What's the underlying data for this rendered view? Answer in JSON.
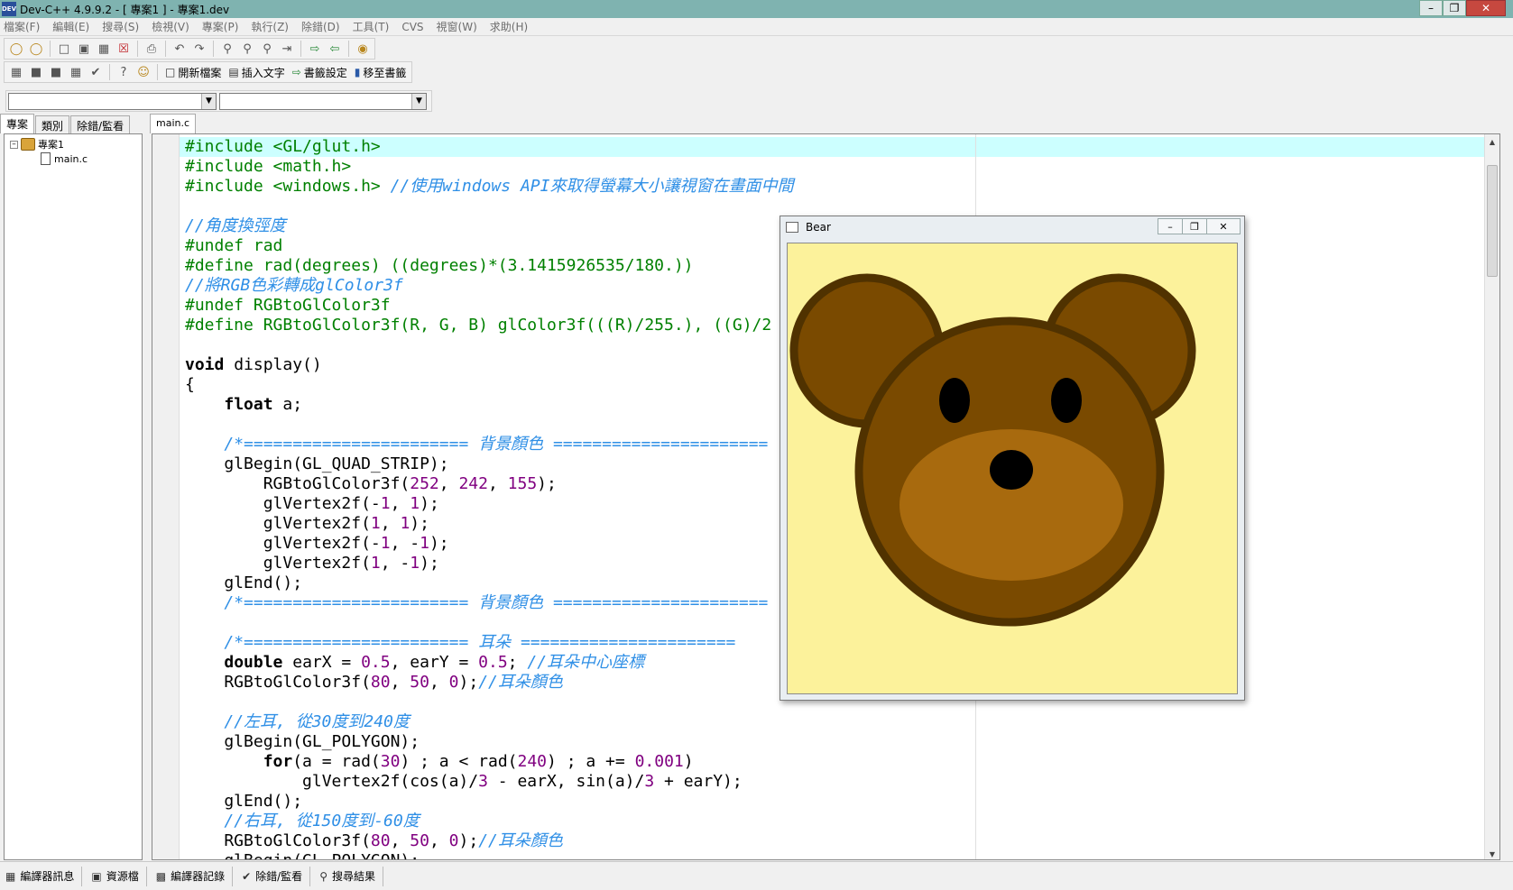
{
  "window": {
    "title": "Dev-C++ 4.9.9.2  - [ 專案1 ] - 專案1.dev",
    "icon_label": "DEV"
  },
  "menu": [
    "檔案(F)",
    "編輯(E)",
    "搜尋(S)",
    "檢視(V)",
    "專案(P)",
    "執行(Z)",
    "除錯(D)",
    "工具(T)",
    "CVS",
    "視窗(W)",
    "求助(H)"
  ],
  "toolbar2": {
    "new_file": "開新檔案",
    "insert_text": "插入文字",
    "bookmark_set": "書籤設定",
    "goto_bookmark": "移至書籤"
  },
  "left_tabs": [
    "專案",
    "類別",
    "除錯/監看"
  ],
  "project_tree": {
    "root": "專案1",
    "file": "main.c"
  },
  "editor_tab": "main.c",
  "bear_window": {
    "title": "Bear",
    "bg_color": "#fcf29b",
    "ear_color": "#7a4a00",
    "outline_color": "#503200",
    "muzzle_color": "#a86a0e"
  },
  "statusbar": [
    "編譯器訊息",
    "資源檔",
    "編譯器記錄",
    "除錯/監看",
    "搜尋結果"
  ],
  "code_lines": [
    [
      [
        "pp",
        "#include <GL/glut.h>"
      ]
    ],
    [
      [
        "pp",
        "#include <math.h>"
      ]
    ],
    [
      [
        "pp",
        "#include <windows.h> "
      ],
      [
        "cm",
        "//使用windows API來取得螢幕大小讓視窗在畫面中間"
      ]
    ],
    [],
    [
      [
        "cm",
        "//角度換弳度"
      ]
    ],
    [
      [
        "pp",
        "#undef rad"
      ]
    ],
    [
      [
        "pp",
        "#define rad(degrees) ((degrees)*(3.1415926535/180.))"
      ]
    ],
    [
      [
        "cm",
        "//將RGB色彩轉成glColor3f"
      ]
    ],
    [
      [
        "pp",
        "#undef RGBtoGlColor3f"
      ]
    ],
    [
      [
        "pp",
        "#define RGBtoGlColor3f(R, G, B) glColor3f(((R)/255.), ((G)/2"
      ]
    ],
    [],
    [
      [
        "kw",
        "void"
      ],
      [
        "tx",
        " display()"
      ]
    ],
    [
      [
        "tx",
        "{"
      ]
    ],
    [
      [
        "tx",
        "    "
      ],
      [
        "kw",
        "float"
      ],
      [
        "tx",
        " a;"
      ]
    ],
    [],
    [
      [
        "tx",
        "    "
      ],
      [
        "cm",
        "/*======================= 背景顏色 ======================"
      ]
    ],
    [
      [
        "tx",
        "    glBegin(GL_QUAD_STRIP);"
      ]
    ],
    [
      [
        "tx",
        "        RGBtoGlColor3f("
      ],
      [
        "num",
        "252"
      ],
      [
        "tx",
        ", "
      ],
      [
        "num",
        "242"
      ],
      [
        "tx",
        ", "
      ],
      [
        "num",
        "155"
      ],
      [
        "tx",
        ");"
      ]
    ],
    [
      [
        "tx",
        "        glVertex2f(-"
      ],
      [
        "num",
        "1"
      ],
      [
        "tx",
        ", "
      ],
      [
        "num",
        "1"
      ],
      [
        "tx",
        ");"
      ]
    ],
    [
      [
        "tx",
        "        glVertex2f("
      ],
      [
        "num",
        "1"
      ],
      [
        "tx",
        ", "
      ],
      [
        "num",
        "1"
      ],
      [
        "tx",
        ");"
      ]
    ],
    [
      [
        "tx",
        "        glVertex2f(-"
      ],
      [
        "num",
        "1"
      ],
      [
        "tx",
        ", -"
      ],
      [
        "num",
        "1"
      ],
      [
        "tx",
        ");"
      ]
    ],
    [
      [
        "tx",
        "        glVertex2f("
      ],
      [
        "num",
        "1"
      ],
      [
        "tx",
        ", -"
      ],
      [
        "num",
        "1"
      ],
      [
        "tx",
        ");"
      ]
    ],
    [
      [
        "tx",
        "    glEnd();"
      ]
    ],
    [
      [
        "tx",
        "    "
      ],
      [
        "cm",
        "/*======================= 背景顏色 ======================"
      ]
    ],
    [],
    [
      [
        "tx",
        "    "
      ],
      [
        "cm",
        "/*======================= 耳朵 ======================"
      ]
    ],
    [
      [
        "tx",
        "    "
      ],
      [
        "kw",
        "double"
      ],
      [
        "tx",
        " earX = "
      ],
      [
        "num",
        "0.5"
      ],
      [
        "tx",
        ", earY = "
      ],
      [
        "num",
        "0.5"
      ],
      [
        "tx",
        "; "
      ],
      [
        "cm",
        "//耳朵中心座標"
      ]
    ],
    [
      [
        "tx",
        "    RGBtoGlColor3f("
      ],
      [
        "num",
        "80"
      ],
      [
        "tx",
        ", "
      ],
      [
        "num",
        "50"
      ],
      [
        "tx",
        ", "
      ],
      [
        "num",
        "0"
      ],
      [
        "tx",
        ");"
      ],
      [
        "cm",
        "//耳朵顏色"
      ]
    ],
    [],
    [
      [
        "tx",
        "    "
      ],
      [
        "cm",
        "//左耳, 從30度到240度"
      ]
    ],
    [
      [
        "tx",
        "    glBegin(GL_POLYGON);"
      ]
    ],
    [
      [
        "tx",
        "        "
      ],
      [
        "kw",
        "for"
      ],
      [
        "tx",
        "(a = rad("
      ],
      [
        "num",
        "30"
      ],
      [
        "tx",
        ") ; a < rad("
      ],
      [
        "num",
        "240"
      ],
      [
        "tx",
        ") ; a += "
      ],
      [
        "num",
        "0.001"
      ],
      [
        "tx",
        ")"
      ]
    ],
    [
      [
        "tx",
        "            glVertex2f(cos(a)/"
      ],
      [
        "num",
        "3"
      ],
      [
        "tx",
        " - earX, sin(a)/"
      ],
      [
        "num",
        "3"
      ],
      [
        "tx",
        " + earY);"
      ]
    ],
    [
      [
        "tx",
        "    glEnd();"
      ]
    ],
    [
      [
        "tx",
        "    "
      ],
      [
        "cm",
        "//右耳, 從150度到-60度"
      ]
    ],
    [
      [
        "tx",
        "    RGBtoGlColor3f("
      ],
      [
        "num",
        "80"
      ],
      [
        "tx",
        ", "
      ],
      [
        "num",
        "50"
      ],
      [
        "tx",
        ", "
      ],
      [
        "num",
        "0"
      ],
      [
        "tx",
        ");"
      ],
      [
        "cm",
        "//耳朵顏色"
      ]
    ],
    [
      [
        "tx",
        "    glBegin(GL_POLYGON);"
      ]
    ]
  ]
}
